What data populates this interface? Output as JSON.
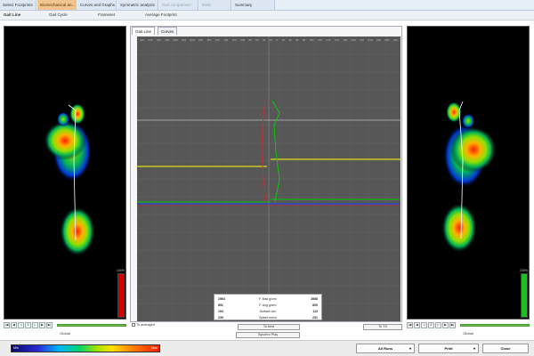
{
  "top_tabs": [
    {
      "label": "Select Footprints",
      "active": false,
      "dim": false
    },
    {
      "label": "Biomechanical an...",
      "active": true,
      "dim": false
    },
    {
      "label": "Curves and Graphs",
      "active": false,
      "dim": false
    },
    {
      "label": "Symmetric analysis",
      "active": false,
      "dim": false
    },
    {
      "label": "Gait comparison",
      "active": false,
      "dim": true
    },
    {
      "label": "EMG",
      "active": false,
      "dim": true
    },
    {
      "label": "Summary",
      "active": false,
      "dim": false
    }
  ],
  "sub_tabs": [
    "Gait Line",
    "Gait Cycle",
    "Frameset",
    "Average Footprint"
  ],
  "center_tabs": [
    "Gait Line",
    "Curves"
  ],
  "left_panel": {
    "caption": "Global",
    "scale_top": "100%"
  },
  "right_panel": {
    "caption": "Global",
    "scale_top": "100%"
  },
  "center": {
    "checkbox_label": "To averaged",
    "button_mid": "To best",
    "button_right": "To TS",
    "sync_button": "Synchro Play"
  },
  "stats": {
    "rows": [
      {
        "left": "2564",
        "label": "F. Max g/cm²",
        "right": "2668"
      },
      {
        "left": "891",
        "label": "F. Avg g/cm²",
        "right": "809"
      },
      {
        "left": "194",
        "label": "Surface cm²",
        "right": "112"
      },
      {
        "left": "239",
        "label": "Speed mm/s",
        "right": "231"
      }
    ]
  },
  "gradient": {
    "left_label": "Min",
    "right_label": "Max"
  },
  "bottom_buttons": [
    "All Runs",
    "Print",
    "Close"
  ],
  "colors": {
    "accent_tab": "#f3c58e",
    "plot_bg": "#575757",
    "line_yellow": "#ffff00",
    "line_blue": "#1e3cff",
    "line_green": "#00c800",
    "line_red": "#d62020",
    "scale_red": "#d10000",
    "scale_green": "#19c21e"
  }
}
